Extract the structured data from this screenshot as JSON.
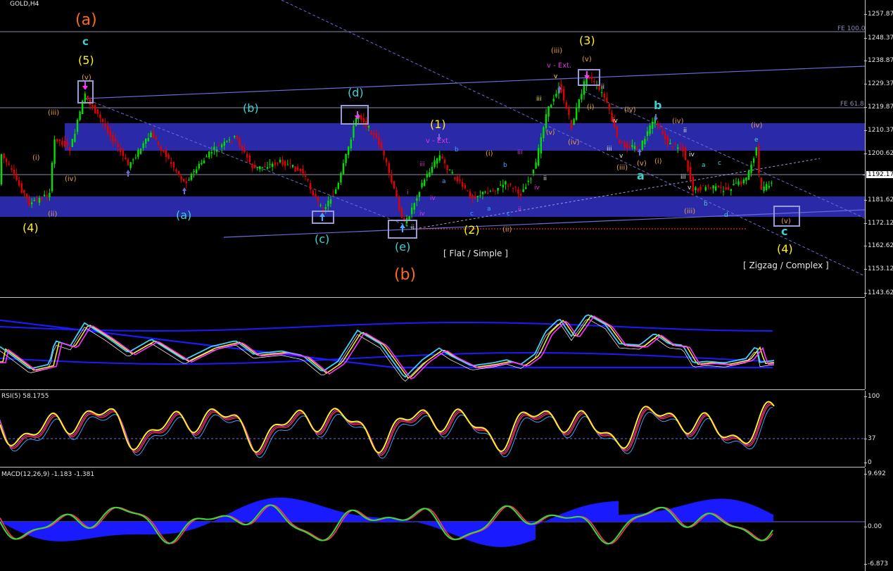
{
  "chart": {
    "symbol_title": "GOLD,H4",
    "price_axis": [
      "1257.87",
      "1248.37",
      "1238.87",
      "1229.37",
      "1219.87",
      "1210.37",
      "1200.62",
      "1192.17",
      "1181.62",
      "1172.12",
      "1162.62",
      "1153.12",
      "1143.62"
    ],
    "current_price": "1192.17",
    "fe_levels": {
      "fe100": "FE 100.0",
      "fe618": "FE 61.8"
    },
    "wave_labels": {
      "a_big": "(a)",
      "c_top": "c",
      "five": "(5)",
      "v_small": "(v)",
      "iii_left": "(iii)",
      "i_left": "(i)",
      "iv_left": "(iv)",
      "ii_left": "(ii)",
      "four_left": "(4)",
      "b_paren": "(b)",
      "a_paren": "(a)",
      "c_paren": "(c)",
      "d_paren": "(d)",
      "e_paren": "(e)",
      "b_big": "(b)",
      "one": "(1)",
      "v_ext_1": "v - Ext.",
      "two": "(2)",
      "ii_mid": "(ii)",
      "flat_simple": "[ Flat / Simple ]",
      "three": "(3)",
      "iii_top": "(iii)",
      "v_top": "(v)",
      "v_ext_2": "v - Ext.",
      "i_top": "(i)",
      "iv_top": "(iv)",
      "b_teal": "b",
      "a_teal": "a",
      "iv_right": "(iv)",
      "iii_right": "(iii)",
      "v_right": "(v)",
      "i_right": "(i)",
      "iii_low": "(iii)",
      "iv_far": "(iv)",
      "v_far": "(v)",
      "c_far": "c",
      "four_far": "(4)",
      "zigzag": "[ Zigzag / Complex ]",
      "small_iii": "iii",
      "small_iv": "iv",
      "small_i": "i",
      "small_a": "a",
      "small_b": "b",
      "small_c": "c",
      "small_d": "d",
      "small_e": "e",
      "small_v": "v",
      "small_ii": "ii"
    }
  },
  "rsi": {
    "title": "RSI(5) 58.1755",
    "axis": [
      "100",
      "37",
      "0"
    ]
  },
  "macd": {
    "title": "MACD(12,26,9) -1.183 -1.381",
    "axis": [
      "9.692",
      "0.00",
      "-6.873"
    ]
  },
  "colors": {
    "bull": "#00e000",
    "bear": "#e00000",
    "zone": "#2a2aa8",
    "trend": "#6b6bd8",
    "yellow": "#ffee22",
    "teal": "#3fd0d0",
    "orange": "#ff6a1a",
    "magenta": "#ff33ff",
    "light_orange": "#e8a040"
  }
}
